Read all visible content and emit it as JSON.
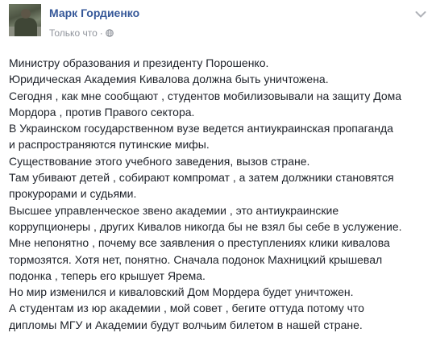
{
  "post": {
    "author": "Марк Гордиенко",
    "timestamp": "Только что",
    "meta_separator": "·",
    "privacy_icon": "globe-icon",
    "menu_icon": "chevron-down-icon",
    "colors": {
      "author_link": "#365899",
      "meta_text": "#90949c",
      "body_text": "#1d2129"
    },
    "lines": [
      "Министру образования и президенту Порошенко.",
      "Юридическая Академия Кивалова должна быть уничтожена.",
      "Сегодня , как мне сообщают , студентов мобилизовывали на защиту Дома",
      "Мордора , против Правого сектора.",
      "В Украинском государственном вузе ведется антиукраинская пропаганда",
      "и распространяются путинские мифы.",
      "Существование этого учебного заведения, вызов стране.",
      "Там убивают детей , собирают компромат , а затем должники становятся",
      "прокурорами и судьями.",
      "Высшее управленческое звено академии , это антиукраинские",
      "коррупционеры , других Кивалов никогда бы не взял бы себе в услужение.",
      "Мне непонятно , почему все заявления о преступлениях клики кивалова",
      "тормозятся. Хотя нет, понятно. Сначала подонок Махницкий крышевал",
      "подонка , теперь его крышует Ярема.",
      "Но мир изменился и киваловский Дом Мордера будет уничтожен.",
      "А студентам из юр академии , мой совет , бегите оттуда потому что",
      "дипломы МГУ и Академии будут волчьим билетом в нашей стране."
    ]
  }
}
